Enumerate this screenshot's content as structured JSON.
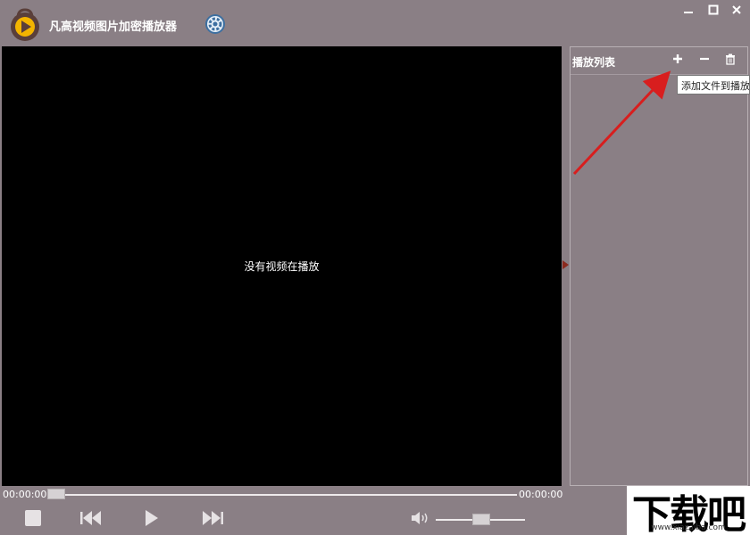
{
  "app": {
    "title": "凡高视频图片加密播放器"
  },
  "window_controls": {
    "minimize": "minimize-icon",
    "maximize": "maximize-icon",
    "close": "close-icon"
  },
  "video": {
    "empty_message": "没有视频在播放"
  },
  "playlist": {
    "title": "播放列表",
    "add_tooltip": "添加文件到播放"
  },
  "playback": {
    "current_time": "00:00:00",
    "total_time": "00:00:00",
    "progress": 0.0,
    "volume": 0.5
  },
  "watermark": {
    "text": "下载吧",
    "url": "www.xiazaiba.com"
  },
  "colors": {
    "background": "#8a7f85",
    "video_bg": "#000000",
    "arrow_annotation": "#d81e1e",
    "logo_accent": "#f4b400"
  }
}
